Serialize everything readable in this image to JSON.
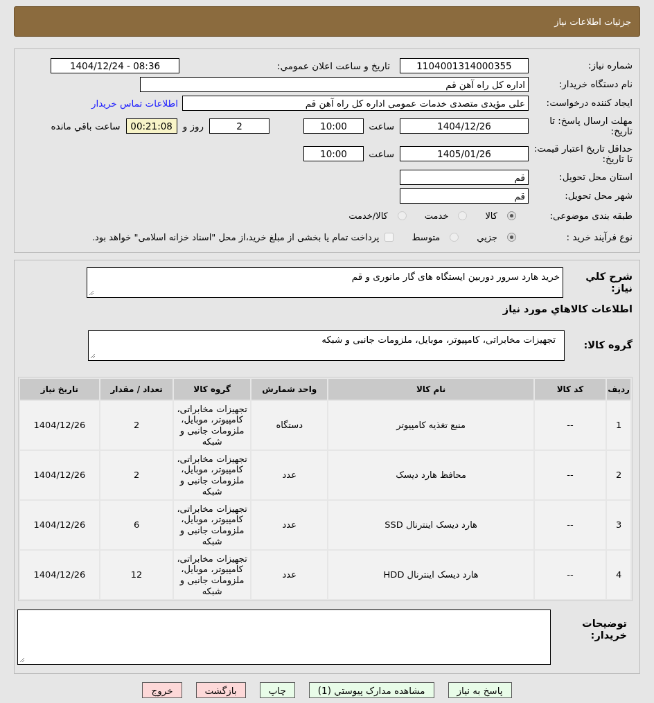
{
  "header": {
    "title": "جزئیات اطلاعات نیاز"
  },
  "info": {
    "need_number": {
      "label": "شماره نیاز:",
      "value": "1104001314000355"
    },
    "announce": {
      "label": "تاریخ و ساعت اعلان عمومي:",
      "value": "1404/12/24 - 08:36"
    },
    "buyer": {
      "label": "نام دستگاه خریدار:",
      "value": "اداره کل  راه آهن قم"
    },
    "requester": {
      "label": "ایجاد کننده درخواست:",
      "value": "علی مؤیدی متصدی خدمات عمومی اداره کل  راه آهن قم",
      "link": "اطلاعات تماس خریدار"
    },
    "deadline": {
      "label": "مهلت ارسال پاسخ: تا تاریخ:",
      "date": "1404/12/26",
      "time_label": "ساعت",
      "time": "10:00",
      "days": "2",
      "days_label": "روز و",
      "remaining": "00:21:08",
      "remaining_label": "ساعت باقي مانده"
    },
    "validity": {
      "label": "حداقل تاریخ اعتبار قیمت: تا تاریخ:",
      "date": "1405/01/26",
      "time_label": "ساعت",
      "time": "10:00"
    },
    "province": {
      "label": "استان محل تحویل:",
      "value": "قم"
    },
    "city": {
      "label": "شهر محل تحویل:",
      "value": "قم"
    },
    "category": {
      "label": "طبقه بندی موضوعی:",
      "options": [
        {
          "label": "کالا",
          "selected": true
        },
        {
          "label": "خدمت",
          "selected": false
        },
        {
          "label": "کالا/خدمت",
          "selected": false
        }
      ]
    },
    "process": {
      "label": "نوع فرآیند خرید :",
      "options": [
        {
          "label": "جزيي",
          "selected": true
        },
        {
          "label": "متوسط",
          "selected": false
        }
      ],
      "treasury": {
        "checked": false,
        "label": "پرداخت تمام یا بخشی از مبلغ خرید،از محل \"اسناد خزانه اسلامی\" خواهد بود."
      }
    }
  },
  "details": {
    "description": {
      "label": "شرح کلي نیاز:",
      "value": "خرید هارد سرور دوربین ایستگاه های گار مانوری  و قم"
    },
    "section_title": "اطلاعات کالاهاي مورد نیاز",
    "group": {
      "label": "گروه کالا:",
      "value": "تجهیزات مخابراتی، کامپیوتر، موبایل، ملزومات جانبی و شبکه"
    },
    "table": {
      "columns": [
        "ردیف",
        "کد کالا",
        "نام کالا",
        "واحد شمارش",
        "گروه کالا",
        "تعداد / مقدار",
        "تاریخ نیاز"
      ],
      "rows": [
        [
          "1",
          "--",
          "منبع تغذیه کامپیوتر",
          "دستگاه",
          "تجهیزات مخابراتی، کامپیوتر، موبایل، ملزومات جانبی و شبکه",
          "2",
          "1404/12/26"
        ],
        [
          "2",
          "--",
          "محافظ هارد دیسک",
          "عدد",
          "تجهیزات مخابراتی، کامپیوتر، موبایل، ملزومات جانبی و شبکه",
          "2",
          "1404/12/26"
        ],
        [
          "3",
          "--",
          "هارد دیسک اینترنال SSD",
          "عدد",
          "تجهیزات مخابراتی، کامپیوتر، موبایل، ملزومات جانبی و شبکه",
          "6",
          "1404/12/26"
        ],
        [
          "4",
          "--",
          "هارد دیسک اینترنال HDD",
          "عدد",
          "تجهیزات مخابراتی، کامپیوتر، موبایل، ملزومات جانبی و شبکه",
          "12",
          "1404/12/26"
        ]
      ]
    },
    "notes": {
      "label": "توضیحات خریدار:"
    }
  },
  "buttons": [
    {
      "label": "پاسخ به نیاز",
      "kind": "primary"
    },
    {
      "label": "مشاهده مدارک پیوستي (1)",
      "kind": "primary"
    },
    {
      "label": "چاپ",
      "kind": "primary"
    },
    {
      "label": "بازگشت",
      "kind": "danger"
    },
    {
      "label": "خروج",
      "kind": "danger"
    }
  ]
}
